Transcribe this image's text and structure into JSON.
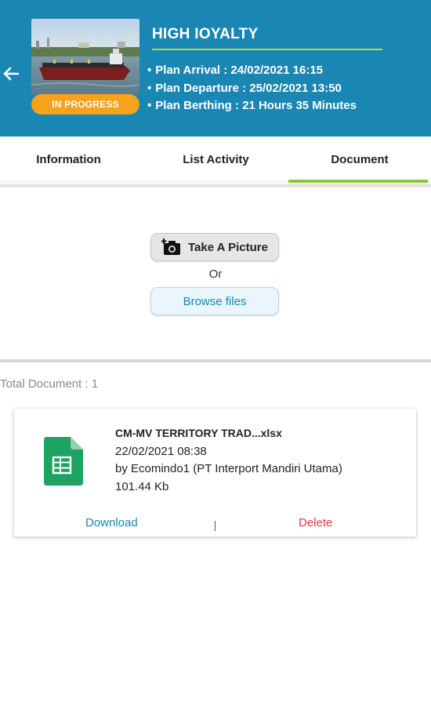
{
  "header": {
    "vessel_name": "HIGH IOYALTY",
    "status_badge": "IN PROGRESS",
    "plan_arrival": "Plan Arrival : 24/02/2021 16:15",
    "plan_departure": "Plan Departure : 25/02/2021 13:50",
    "plan_berthing": "Plan Berthing : 21 Hours 35 Minutes",
    "accent_color": "#1a86b3",
    "badge_color": "#f6a21a"
  },
  "tabs": [
    {
      "label": "Information"
    },
    {
      "label": "List Activity"
    },
    {
      "label": "Document",
      "active": true
    }
  ],
  "upload": {
    "take_picture_label": "Take A Picture",
    "or_label": "Or",
    "browse_label": "Browse files"
  },
  "documents": {
    "total_label": "Total Document : 1",
    "items": [
      {
        "file_name": "CM-MV TERRITORY TRAD...xlsx",
        "date": "22/02/2021 08:38",
        "uploaded_by": "by Ecomindo1 (PT Interport Mandiri Utama)",
        "size": "101.44 Kb",
        "download_label": "Download",
        "separator": "|",
        "delete_label": "Delete",
        "icon": "spreadsheet-file-icon"
      }
    ]
  }
}
